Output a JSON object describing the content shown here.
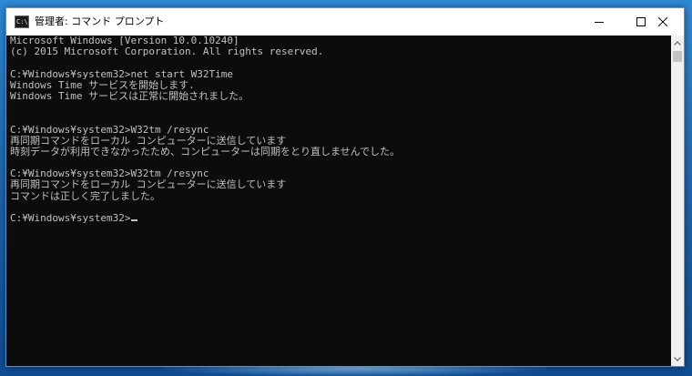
{
  "window": {
    "title": "管理者: コマンド プロンプト",
    "icon_label": "C:\\"
  },
  "console": {
    "lines": [
      "Microsoft Windows [Version 10.0.10240]",
      "(c) 2015 Microsoft Corporation. All rights reserved.",
      "",
      "C:¥Windows¥system32>net start W32Time",
      "Windows Time サービスを開始します.",
      "Windows Time サービスは正常に開始されました。",
      "",
      "",
      "C:¥Windows¥system32>W32tm /resync",
      "再同期コマンドをローカル コンピューターに送信しています",
      "時刻データが利用できなかったため、コンピューターは同期をとり直しませんでした。",
      "",
      "C:¥Windows¥system32>W32tm /resync",
      "再同期コマンドをローカル コンピューターに送信しています",
      "コマンドは正しく完了しました。",
      "",
      "C:¥Windows¥system32>"
    ]
  },
  "icons": {
    "app": "command-prompt-icon",
    "minimize": "minimize-icon",
    "maximize": "maximize-icon",
    "close": "close-icon",
    "scroll_up": "scroll-up-arrow-icon",
    "scroll_down": "scroll-down-arrow-icon"
  },
  "colors": {
    "console_background": "#0c0c0c",
    "console_text": "#c0c0c0",
    "titlebar": "#ffffff",
    "desktop": "#1f6fb8"
  }
}
